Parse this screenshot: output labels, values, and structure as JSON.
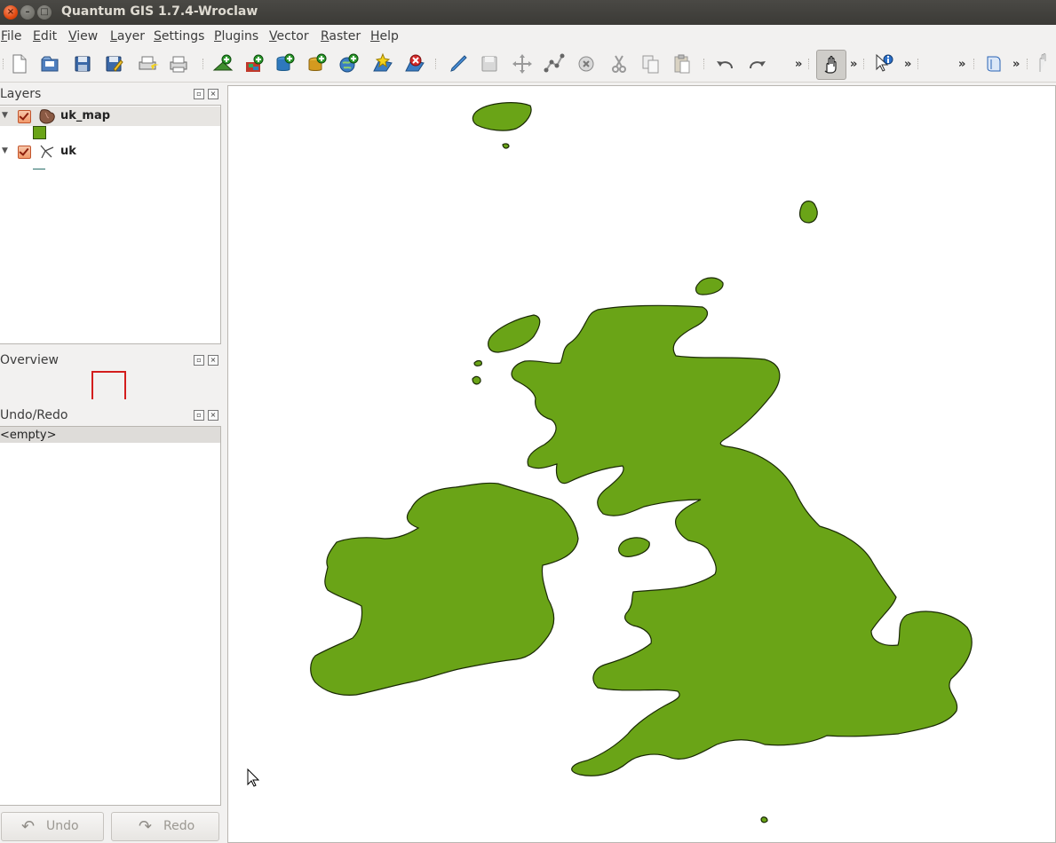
{
  "window": {
    "title": "Quantum GIS 1.7.4-Wroclaw",
    "close_glyph": "×",
    "min_glyph": "–",
    "max_glyph": "□"
  },
  "menu": [
    {
      "label": "File"
    },
    {
      "label": "Edit"
    },
    {
      "label": "View"
    },
    {
      "label": "Layer"
    },
    {
      "label": "Settings"
    },
    {
      "label": "Plugins"
    },
    {
      "label": "Vector"
    },
    {
      "label": "Raster"
    },
    {
      "label": "Help"
    }
  ],
  "toolbar": {
    "icons": [
      "new-project-icon",
      "open-project-icon",
      "save-project-icon",
      "save-as-icon",
      "print-composer-icon",
      "print-icon",
      "add-vector-layer-icon",
      "add-raster-layer-icon",
      "add-postgis-layer-icon",
      "add-spatialite-layer-icon",
      "add-wms-layer-icon",
      "new-shapefile-icon",
      "remove-layer-icon",
      "toggle-editing-icon",
      "save-edits-icon",
      "move-feature-icon",
      "node-tool-icon",
      "delete-selected-icon",
      "cut-features-icon",
      "copy-features-icon",
      "paste-features-icon",
      "undo-icon",
      "redo-icon",
      "pan-icon",
      "identify-icon",
      "help-icon",
      "zoom-icon"
    ],
    "overflow_glyph": "»"
  },
  "layers_panel": {
    "title": "Layers",
    "layers": [
      {
        "name": "uk_map",
        "checked": true,
        "expanded": true,
        "symbol_color": "#6aa417"
      },
      {
        "name": "uk",
        "checked": true,
        "expanded": true
      }
    ],
    "expand_glyph": "▼"
  },
  "overview_panel": {
    "title": "Overview"
  },
  "undo_panel": {
    "title": "Undo/Redo",
    "empty_label": "<empty>",
    "undo_label": "Undo",
    "redo_label": "Redo",
    "undo_glyph": "↶",
    "redo_glyph": "↷"
  },
  "dock_glyphs": {
    "float": "▫",
    "close": "×"
  },
  "colors": {
    "land_fill": "#6aa417",
    "land_stroke": "#1a2a05",
    "overview_extent": "#d31d1d",
    "accent": "#e0480f"
  }
}
